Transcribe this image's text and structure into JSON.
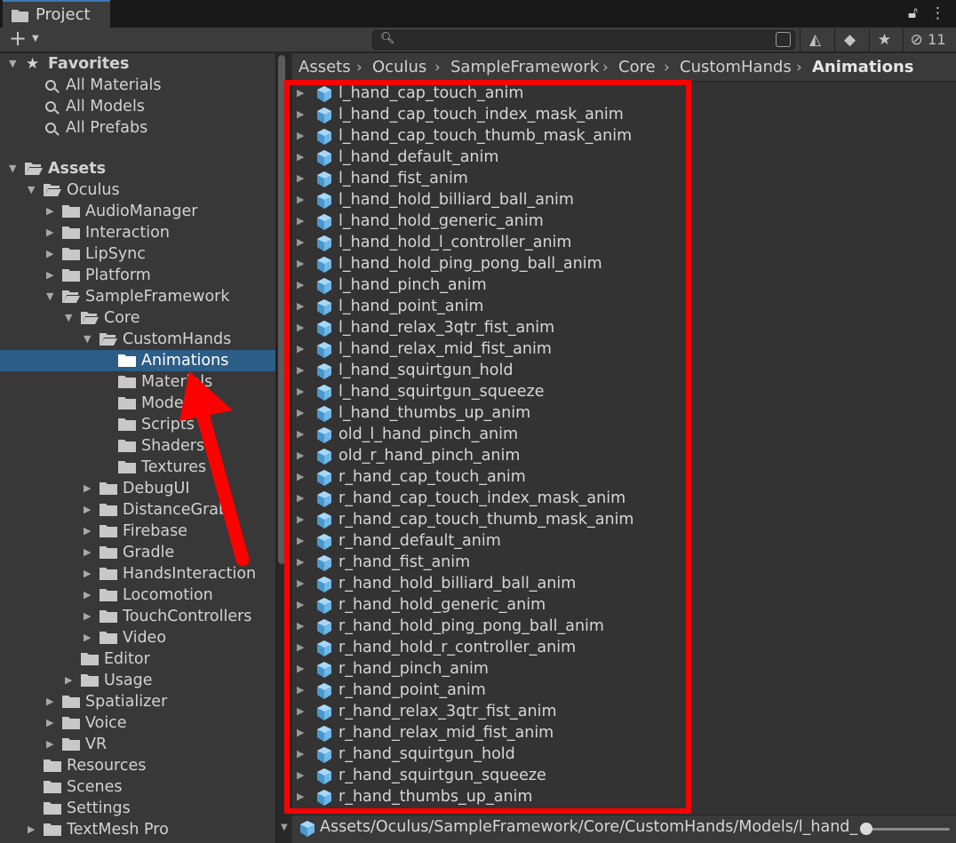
{
  "window": {
    "tab_title": "Project",
    "hidden_count": "11"
  },
  "toolbar": {
    "add_label": "+",
    "search_placeholder": ""
  },
  "favorites": {
    "label": "Favorites",
    "items": [
      "All Materials",
      "All Models",
      "All Prefabs"
    ]
  },
  "tree": [
    {
      "label": "Assets",
      "depth": 0,
      "expand": "open",
      "bold": true
    },
    {
      "label": "Oculus",
      "depth": 1,
      "expand": "open"
    },
    {
      "label": "AudioManager",
      "depth": 2,
      "expand": "closed"
    },
    {
      "label": "Interaction",
      "depth": 2,
      "expand": "closed"
    },
    {
      "label": "LipSync",
      "depth": 2,
      "expand": "closed"
    },
    {
      "label": "Platform",
      "depth": 2,
      "expand": "closed"
    },
    {
      "label": "SampleFramework",
      "depth": 2,
      "expand": "open"
    },
    {
      "label": "Core",
      "depth": 3,
      "expand": "open"
    },
    {
      "label": "CustomHands",
      "depth": 4,
      "expand": "open"
    },
    {
      "label": "Animations",
      "depth": 5,
      "expand": "none",
      "selected": true
    },
    {
      "label": "Materials",
      "depth": 5,
      "expand": "none"
    },
    {
      "label": "Models",
      "depth": 5,
      "expand": "none"
    },
    {
      "label": "Scripts",
      "depth": 5,
      "expand": "none"
    },
    {
      "label": "Shaders",
      "depth": 5,
      "expand": "none"
    },
    {
      "label": "Textures",
      "depth": 5,
      "expand": "none"
    },
    {
      "label": "DebugUI",
      "depth": 4,
      "expand": "closed"
    },
    {
      "label": "DistanceGrab",
      "depth": 4,
      "expand": "closed"
    },
    {
      "label": "Firebase",
      "depth": 4,
      "expand": "closed"
    },
    {
      "label": "Gradle",
      "depth": 4,
      "expand": "closed"
    },
    {
      "label": "HandsInteraction",
      "depth": 4,
      "expand": "closed"
    },
    {
      "label": "Locomotion",
      "depth": 4,
      "expand": "closed"
    },
    {
      "label": "TouchControllers",
      "depth": 4,
      "expand": "closed"
    },
    {
      "label": "Video",
      "depth": 4,
      "expand": "closed"
    },
    {
      "label": "Editor",
      "depth": 3,
      "expand": "none"
    },
    {
      "label": "Usage",
      "depth": 3,
      "expand": "closed"
    },
    {
      "label": "Spatializer",
      "depth": 2,
      "expand": "closed"
    },
    {
      "label": "Voice",
      "depth": 2,
      "expand": "closed"
    },
    {
      "label": "VR",
      "depth": 2,
      "expand": "closed"
    },
    {
      "label": "Resources",
      "depth": 1,
      "expand": "none"
    },
    {
      "label": "Scenes",
      "depth": 1,
      "expand": "none"
    },
    {
      "label": "Settings",
      "depth": 1,
      "expand": "none"
    },
    {
      "label": "TextMesh Pro",
      "depth": 1,
      "expand": "closed"
    }
  ],
  "breadcrumb": [
    "Assets",
    "Oculus",
    "SampleFramework",
    "Core",
    "CustomHands",
    "Animations"
  ],
  "files": [
    "l_hand_cap_touch_anim",
    "l_hand_cap_touch_index_mask_anim",
    "l_hand_cap_touch_thumb_mask_anim",
    "l_hand_default_anim",
    "l_hand_fist_anim",
    "l_hand_hold_billiard_ball_anim",
    "l_hand_hold_generic_anim",
    "l_hand_hold_l_controller_anim",
    "l_hand_hold_ping_pong_ball_anim",
    "l_hand_pinch_anim",
    "l_hand_point_anim",
    "l_hand_relax_3qtr_fist_anim",
    "l_hand_relax_mid_fist_anim",
    "l_hand_squirtgun_hold",
    "l_hand_squirtgun_squeeze",
    "l_hand_thumbs_up_anim",
    "old_l_hand_pinch_anim",
    "old_r_hand_pinch_anim",
    "r_hand_cap_touch_anim",
    "r_hand_cap_touch_index_mask_anim",
    "r_hand_cap_touch_thumb_mask_anim",
    "r_hand_default_anim",
    "r_hand_fist_anim",
    "r_hand_hold_billiard_ball_anim",
    "r_hand_hold_generic_anim",
    "r_hand_hold_ping_pong_ball_anim",
    "r_hand_hold_r_controller_anim",
    "r_hand_pinch_anim",
    "r_hand_point_anim",
    "r_hand_relax_3qtr_fist_anim",
    "r_hand_relax_mid_fist_anim",
    "r_hand_squirtgun_hold",
    "r_hand_squirtgun_squeeze",
    "r_hand_thumbs_up_anim"
  ],
  "status": {
    "path": "Assets/Oculus/SampleFramework/Core/CustomHands/Models/l_hand_"
  },
  "colors": {
    "selection": "#2c5d87",
    "annotation": "#ff0000",
    "prefab_icon": "#6fb7e8"
  }
}
